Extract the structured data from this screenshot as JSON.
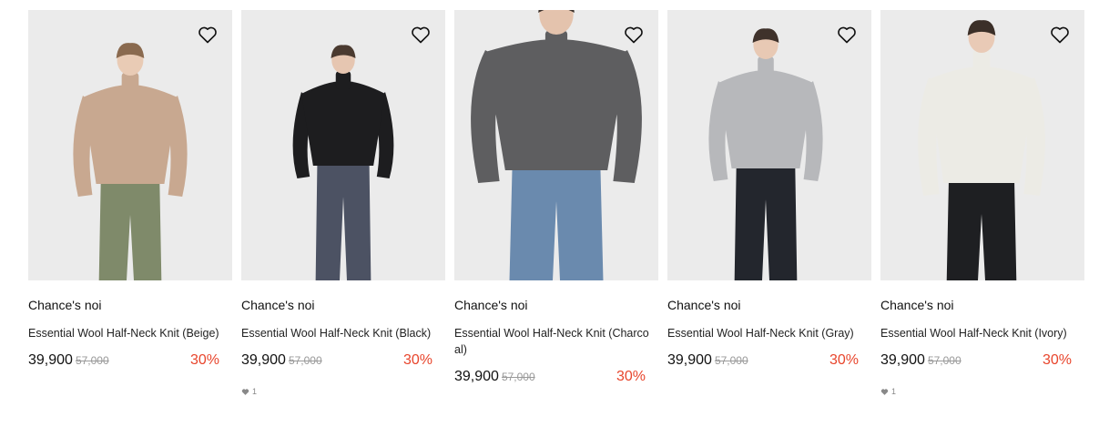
{
  "products": [
    {
      "brand": "Chance's noi",
      "name": "Essential Wool Half-Neck Knit (Beige)",
      "sale_price": "39,900",
      "original_price": "57,000",
      "discount": "30%",
      "likes": "",
      "top_color": "#c8a890",
      "bottom_color": "#7f8a6a",
      "skin": "#e9cbb5",
      "hair": "#8a6a4f"
    },
    {
      "brand": "Chance's noi",
      "name": "Essential Wool Half-Neck Knit (Black)",
      "sale_price": "39,900",
      "original_price": "57,000",
      "discount": "30%",
      "likes": "1",
      "top_color": "#1d1d1f",
      "bottom_color": "#4c5263",
      "skin": "#e6c6b1",
      "hair": "#4a3a30"
    },
    {
      "brand": "Chance's noi",
      "name": "Essential Wool Half-Neck Knit (Charcoal)",
      "sale_price": "39,900",
      "original_price": "57,000",
      "discount": "30%",
      "likes": "",
      "top_color": "#5e5e60",
      "bottom_color": "#6a8aae",
      "skin": "#e4c3ad",
      "hair": "#3a302a"
    },
    {
      "brand": "Chance's noi",
      "name": "Essential Wool Half-Neck Knit (Gray)",
      "sale_price": "39,900",
      "original_price": "57,000",
      "discount": "30%",
      "likes": "",
      "top_color": "#b7b8bb",
      "bottom_color": "#23262d",
      "skin": "#e8c9b4",
      "hair": "#3f322b"
    },
    {
      "brand": "Chance's noi",
      "name": "Essential Wool Half-Neck Knit (Ivory)",
      "sale_price": "39,900",
      "original_price": "57,000",
      "discount": "30%",
      "likes": "1",
      "top_color": "#ecebe5",
      "bottom_color": "#1e1f22",
      "skin": "#e9cab6",
      "hair": "#3b2f28"
    }
  ]
}
